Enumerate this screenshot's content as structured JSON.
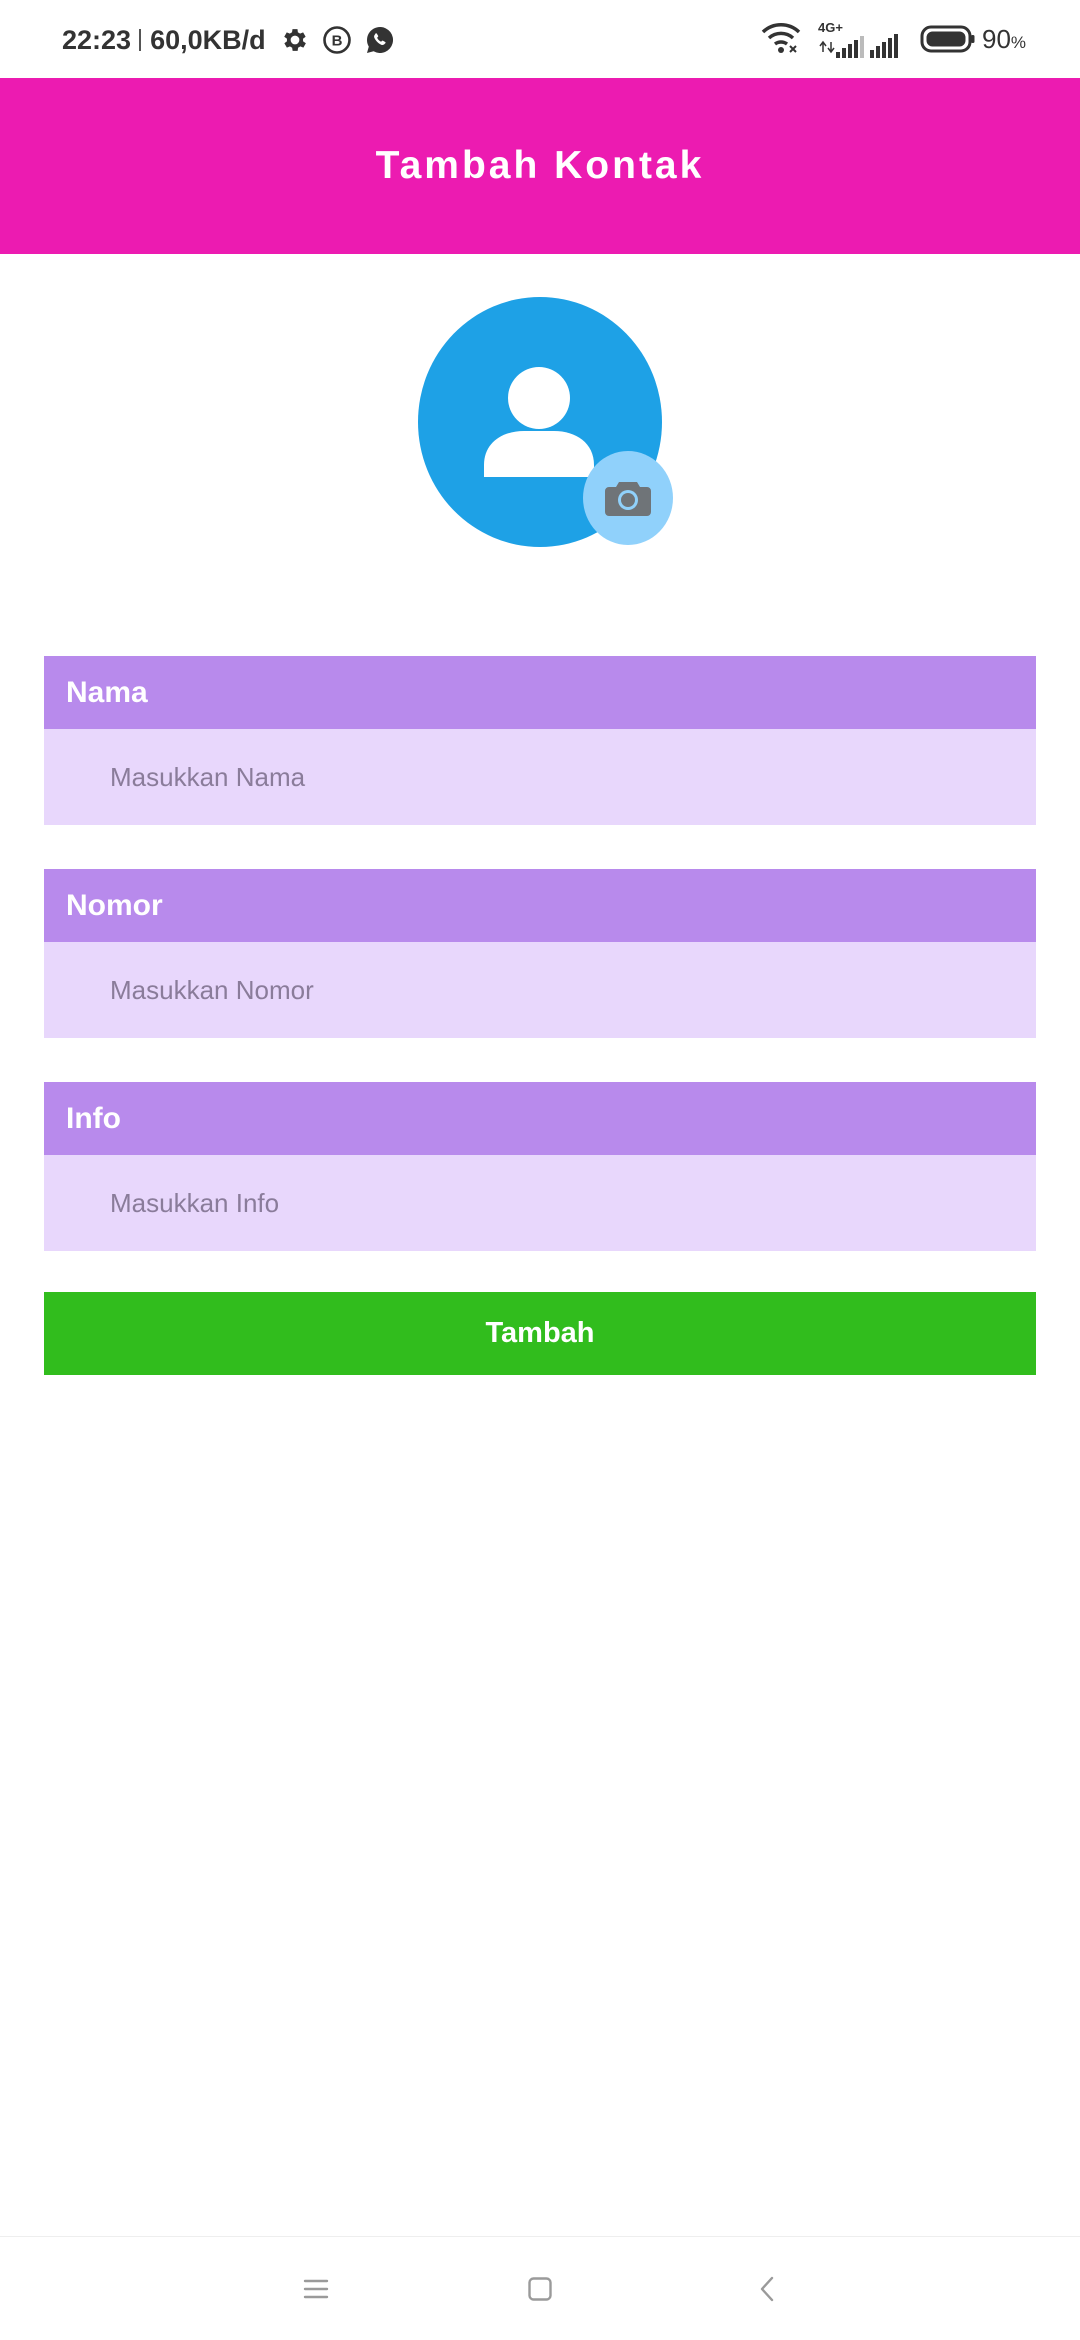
{
  "status_bar": {
    "time": "22:23",
    "network_speed": "60,0KB/d",
    "network_type": "4G+",
    "battery_percent": "90",
    "battery_unit": "%",
    "icons": [
      "gear-icon",
      "b-circle-icon",
      "whatsapp-icon",
      "wifi-icon",
      "signal-4g-icon",
      "signal-icon",
      "battery-icon"
    ]
  },
  "appbar": {
    "title": "Tambah Kontak",
    "color": "#ec1bb1"
  },
  "avatar": {
    "icon": "person-icon",
    "camera_icon": "camera-icon",
    "color": "#1ea1e6"
  },
  "form": {
    "name": {
      "label": "Nama",
      "placeholder": "Masukkan Nama",
      "value": ""
    },
    "number": {
      "label": "Nomor",
      "placeholder": "Masukkan Nomor",
      "value": ""
    },
    "info": {
      "label": "Info",
      "placeholder": "Masukkan Info",
      "value": ""
    },
    "header_color": "#b88aec",
    "input_color": "#e8d7fc"
  },
  "submit": {
    "label": "Tambah",
    "color": "#31bd1d"
  },
  "navbar": {
    "icons": [
      "menu-icon",
      "home-icon",
      "back-icon"
    ]
  }
}
